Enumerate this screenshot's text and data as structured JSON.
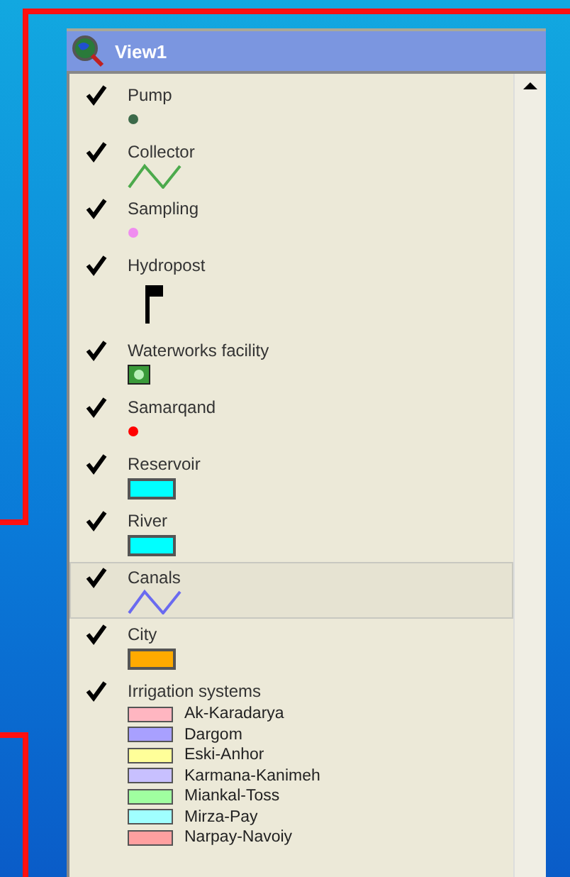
{
  "window": {
    "title": "View1"
  },
  "layers": [
    {
      "name": "Pump",
      "checked": true,
      "selected": false,
      "kind": "dot",
      "color": "#3c6a4a"
    },
    {
      "name": "Collector",
      "checked": true,
      "selected": false,
      "kind": "line",
      "color": "#4caa4c"
    },
    {
      "name": "Sampling",
      "checked": true,
      "selected": false,
      "kind": "dot",
      "color": "#f08cf0"
    },
    {
      "name": "Hydropost",
      "checked": true,
      "selected": false,
      "kind": "flag",
      "color": "#000000"
    },
    {
      "name": "Waterworks facility",
      "checked": true,
      "selected": false,
      "kind": "facility",
      "color": "#3a9a3a"
    },
    {
      "name": "Samarqand",
      "checked": true,
      "selected": false,
      "kind": "dot",
      "color": "#ff0000"
    },
    {
      "name": "Reservoir",
      "checked": true,
      "selected": false,
      "kind": "fill",
      "color": "#00ffff"
    },
    {
      "name": "River",
      "checked": true,
      "selected": false,
      "kind": "fill",
      "color": "#00ffff"
    },
    {
      "name": "Canals",
      "checked": true,
      "selected": true,
      "kind": "line",
      "color": "#6a6af0"
    },
    {
      "name": "City",
      "checked": true,
      "selected": false,
      "kind": "fill",
      "color": "#ffaa00"
    },
    {
      "name": "Irrigation systems",
      "checked": true,
      "selected": false,
      "kind": "classes",
      "children": [
        {
          "name": "Ak-Karadarya",
          "color": "#ffb6c1"
        },
        {
          "name": "Dargom",
          "color": "#a8a0ff"
        },
        {
          "name": "Eski-Anhor",
          "color": "#ffff99"
        },
        {
          "name": "Karmana-Kanimeh",
          "color": "#c8c0ff"
        },
        {
          "name": "Miankal-Toss",
          "color": "#a0ffa0"
        },
        {
          "name": "Mirza-Pay",
          "color": "#a0ffff"
        },
        {
          "name": "Narpay-Navoiy",
          "color": "#ffa0a0"
        }
      ]
    }
  ]
}
